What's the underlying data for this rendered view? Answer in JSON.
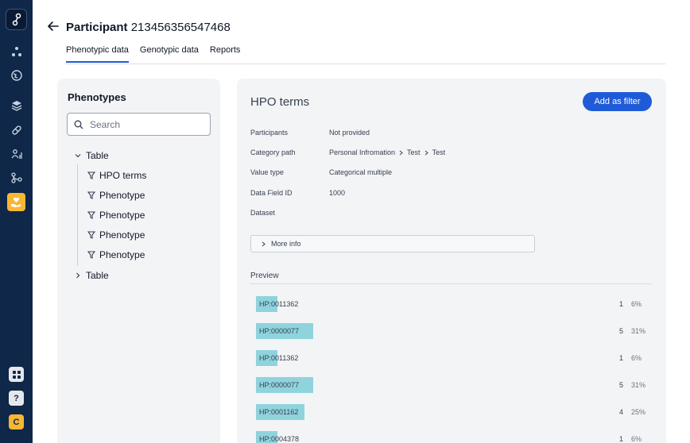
{
  "rail": {
    "icons": [
      "app-logo-icon",
      "dots-network-icon",
      "globe-icon",
      "layers-icon",
      "pill-icon",
      "people-chart-icon",
      "branch-icon",
      "heart-hand-icon",
      "grid-apps-icon",
      "help-icon",
      "user-initial-avatar"
    ],
    "help_label": "?",
    "user_initial": "C",
    "colors": {
      "background": "#0f2748",
      "active": "#f7b733"
    }
  },
  "header": {
    "title_prefix": "Participant",
    "participant_id": "213456356547468",
    "tabs": [
      {
        "label": "Phenotypic data",
        "active": true
      },
      {
        "label": "Genotypic data",
        "active": false
      },
      {
        "label": "Reports",
        "active": false
      }
    ]
  },
  "phenotypes_panel": {
    "title": "Phenotypes",
    "search_placeholder": "Search",
    "tree": [
      {
        "label": "Table",
        "expanded": true,
        "children": [
          "HPO terms",
          "Phenotype",
          "Phenotype",
          "Phenotype",
          "Phenotype"
        ]
      },
      {
        "label": "Table",
        "expanded": false,
        "children": []
      }
    ]
  },
  "detail": {
    "title": "HPO terms",
    "add_filter_label": "Add as filter",
    "fields": [
      {
        "label": "Participants",
        "value": "Not provided"
      },
      {
        "label": "Category path",
        "path": [
          "Personal Infromation",
          "Test",
          "Test"
        ]
      },
      {
        "label": "Value type",
        "value": "Categorical multiple"
      },
      {
        "label": "Data Field ID",
        "value": "1000"
      },
      {
        "label": "Dataset",
        "value": ""
      }
    ],
    "more_info_label": "More info",
    "preview_label": "Preview",
    "preview_rows": [
      {
        "term": "HP:0011362",
        "count": "1",
        "percent": "6%",
        "fraction": 0.06
      },
      {
        "term": "HP:0000077",
        "count": "5",
        "percent": "31%",
        "fraction": 0.31
      },
      {
        "term": "HP:0011362",
        "count": "1",
        "percent": "6%",
        "fraction": 0.06
      },
      {
        "term": "HP:0000077",
        "count": "5",
        "percent": "31%",
        "fraction": 0.31
      },
      {
        "term": "HP:0001162",
        "count": "4",
        "percent": "25%",
        "fraction": 0.25
      },
      {
        "term": "HP:0004378",
        "count": "1",
        "percent": "6%",
        "fraction": 0.06
      }
    ],
    "colors": {
      "accent": "#1f5bd8",
      "highlight": "#8fd3dd"
    }
  }
}
